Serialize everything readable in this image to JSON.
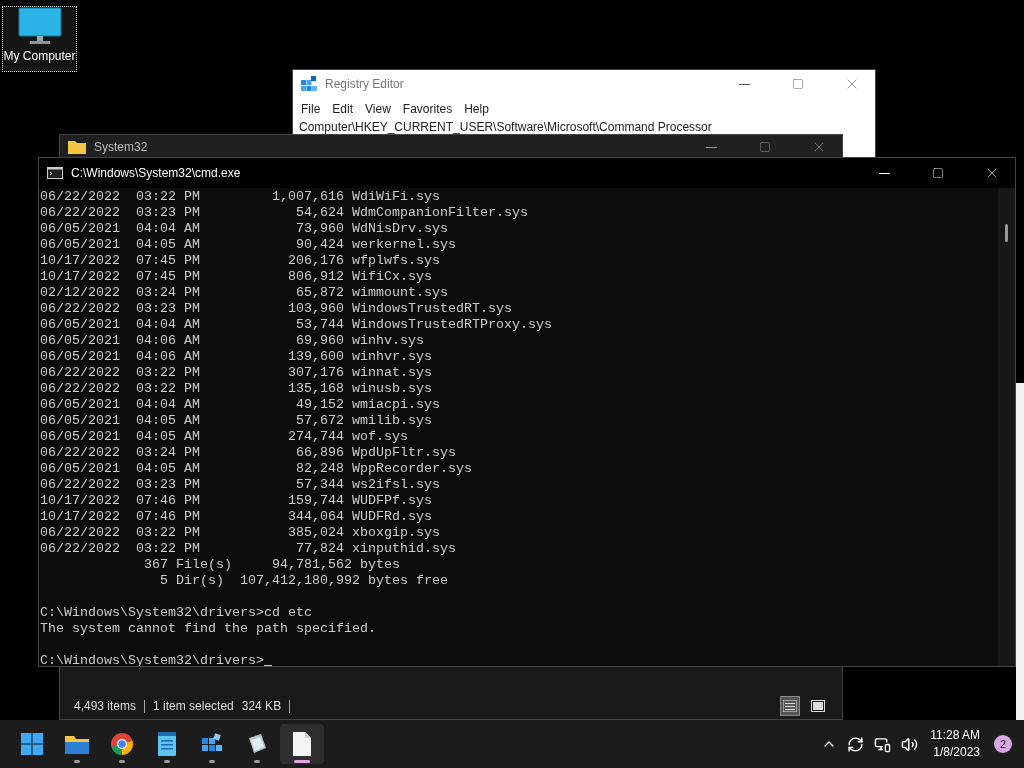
{
  "desktop_icon": {
    "label": "My Computer",
    "selected": true
  },
  "registry_editor": {
    "title": "Registry Editor",
    "menu": [
      "File",
      "Edit",
      "View",
      "Favorites",
      "Help"
    ],
    "address": "Computer\\HKEY_CURRENT_USER\\Software\\Microsoft\\Command Processor"
  },
  "explorer": {
    "title": "System32",
    "status": {
      "items": "4,493 items",
      "selection": "1 item selected",
      "size": "324 KB"
    },
    "views": [
      {
        "kind": "details",
        "selected": true
      },
      {
        "kind": "tiles",
        "selected": false
      }
    ]
  },
  "console": {
    "title": "C:\\Windows\\System32\\cmd.exe",
    "blocks": [
      {
        "lines": [
          "06/22/2022  03:22 PM         1,007,616 WdiWiFi.sys",
          "06/22/2022  03:23 PM            54,624 WdmCompanionFilter.sys",
          "06/05/2021  04:04 AM            73,960 WdNisDrv.sys",
          "06/05/2021  04:05 AM            90,424 werkernel.sys",
          "10/17/2022  07:45 PM           206,176 wfplwfs.sys",
          "10/17/2022  07:45 PM           806,912 WifiCx.sys",
          "02/12/2022  03:24 PM            65,872 wimmount.sys",
          "06/22/2022  03:23 PM           103,960 WindowsTrustedRT.sys",
          "06/05/2021  04:04 AM            53,744 WindowsTrustedRTProxy.sys",
          "06/05/2021  04:06 AM            69,960 winhv.sys",
          "06/05/2021  04:06 AM           139,600 winhvr.sys",
          "06/22/2022  03:22 PM           307,176 winnat.sys",
          "06/22/2022  03:22 PM           135,168 winusb.sys",
          "06/05/2021  04:04 AM            49,152 wmiacpi.sys",
          "06/05/2021  04:05 AM            57,672 wmilib.sys",
          "06/05/2021  04:05 AM           274,744 wof.sys",
          "06/22/2022  03:24 PM            66,896 WpdUpFltr.sys",
          "06/05/2021  04:05 AM            82,248 WppRecorder.sys",
          "06/22/2022  03:23 PM            57,344 ws2ifsl.sys",
          "10/17/2022  07:46 PM           159,744 WUDFPf.sys",
          "10/17/2022  07:46 PM           344,064 WUDFRd.sys",
          "06/22/2022  03:22 PM           385,024 xboxgip.sys",
          "06/22/2022  03:22 PM            77,824 xinputhid.sys",
          "             367 File(s)     94,781,562 bytes",
          "               5 Dir(s)  107,412,180,992 bytes free"
        ],
        "cursor": false
      },
      {
        "lines": [
          "C:\\Windows\\System32\\drivers>cd etc",
          "The system cannot find the path specified."
        ],
        "cursor": false
      },
      {
        "lines": [
          "C:\\Windows\\System32\\drivers>"
        ],
        "cursor": true
      }
    ]
  },
  "taskbar": {
    "apps": [
      {
        "kind": "start",
        "running": false,
        "selected": false
      },
      {
        "kind": "explorer",
        "running": true,
        "selected": false
      },
      {
        "kind": "browser",
        "running": true,
        "selected": false
      },
      {
        "kind": "notepad",
        "running": true,
        "selected": false
      },
      {
        "kind": "registry",
        "running": true,
        "selected": false
      },
      {
        "kind": "cube",
        "running": true,
        "selected": false
      },
      {
        "kind": "document",
        "running": true,
        "selected": true
      }
    ],
    "time": "11:28 AM",
    "date": "1/8/2023",
    "notifications": "2"
  }
}
